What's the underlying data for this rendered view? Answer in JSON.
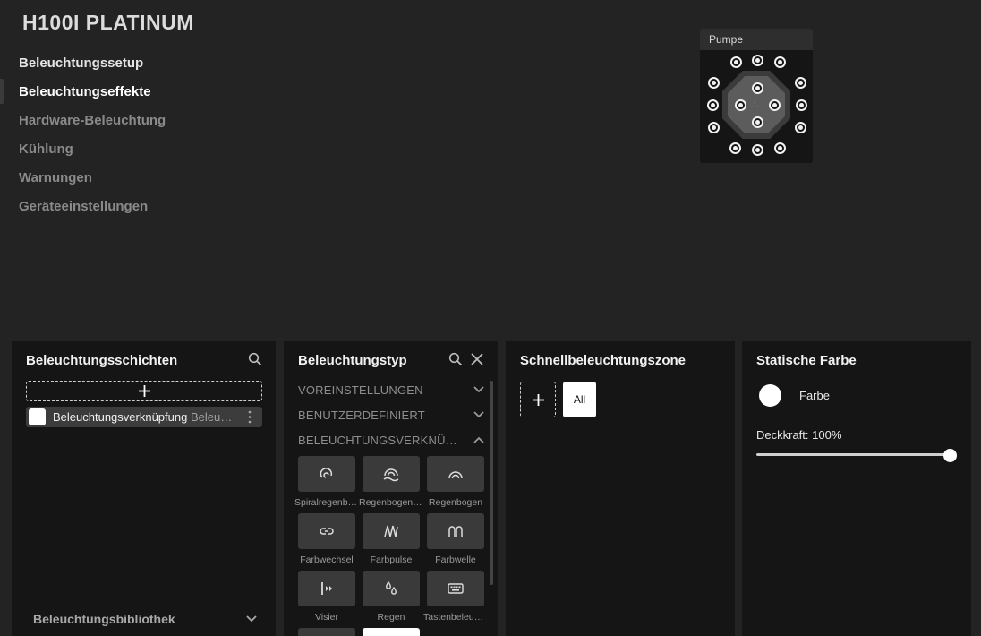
{
  "app": {
    "title": "H100I PLATINUM"
  },
  "nav": {
    "items": [
      {
        "label": "Beleuchtungssetup"
      },
      {
        "label": "Beleuchtungseffekte"
      },
      {
        "label": "Hardware-Beleuchtung"
      },
      {
        "label": "Kühlung"
      },
      {
        "label": "Warnungen"
      },
      {
        "label": "Geräteeinstellungen"
      }
    ],
    "active_index": 1
  },
  "device_preview": {
    "label": "Pumpe",
    "led_count": 20,
    "icon": "corsair-logo-icon"
  },
  "layers_panel": {
    "title": "Beleuchtungsschichten",
    "add_icon": "plus-icon",
    "search_icon": "search-icon",
    "layers": [
      {
        "name": "Beleuchtungsverknüpfung",
        "type": "Beleuchtungsverknüpfung",
        "color": "#ffffff"
      }
    ],
    "library_label": "Beleuchtungsbibliothek"
  },
  "type_panel": {
    "title": "Beleuchtungstyp",
    "sections": [
      {
        "label": "VOREINSTELLUNGEN",
        "expanded": false
      },
      {
        "label": "BENUTZERDEFINIERT",
        "expanded": false
      },
      {
        "label": "BELEUCHTUNGSVERKNÜPFUNG",
        "expanded": true
      }
    ],
    "effects": [
      {
        "label": "Spiralregenbogen",
        "icon": "spiral-rainbow-icon"
      },
      {
        "label": "Regenbogenwelle",
        "icon": "rainbow-wave-icon"
      },
      {
        "label": "Regenbogen",
        "icon": "rainbow-icon"
      },
      {
        "label": "Farbwechsel",
        "icon": "color-shift-icon"
      },
      {
        "label": "Farbpulse",
        "icon": "color-pulse-icon"
      },
      {
        "label": "Farbwelle",
        "icon": "color-wave-icon"
      },
      {
        "label": "Visier",
        "icon": "visor-icon"
      },
      {
        "label": "Regen",
        "icon": "rain-icon"
      },
      {
        "label": "Tastenbeleuchtung",
        "icon": "keyboard-icon"
      }
    ]
  },
  "zone_panel": {
    "title": "Schnellbeleuchtungszone",
    "zones": [
      {
        "label": "All"
      }
    ]
  },
  "color_panel": {
    "title": "Statische Farbe",
    "color_label": "Farbe",
    "color": "#ffffff",
    "opacity_label": "Deckkraft: 100%",
    "opacity": 1.0
  },
  "colors": {
    "background": "#232323",
    "panel": "#151515",
    "accent": "#ffffff"
  }
}
